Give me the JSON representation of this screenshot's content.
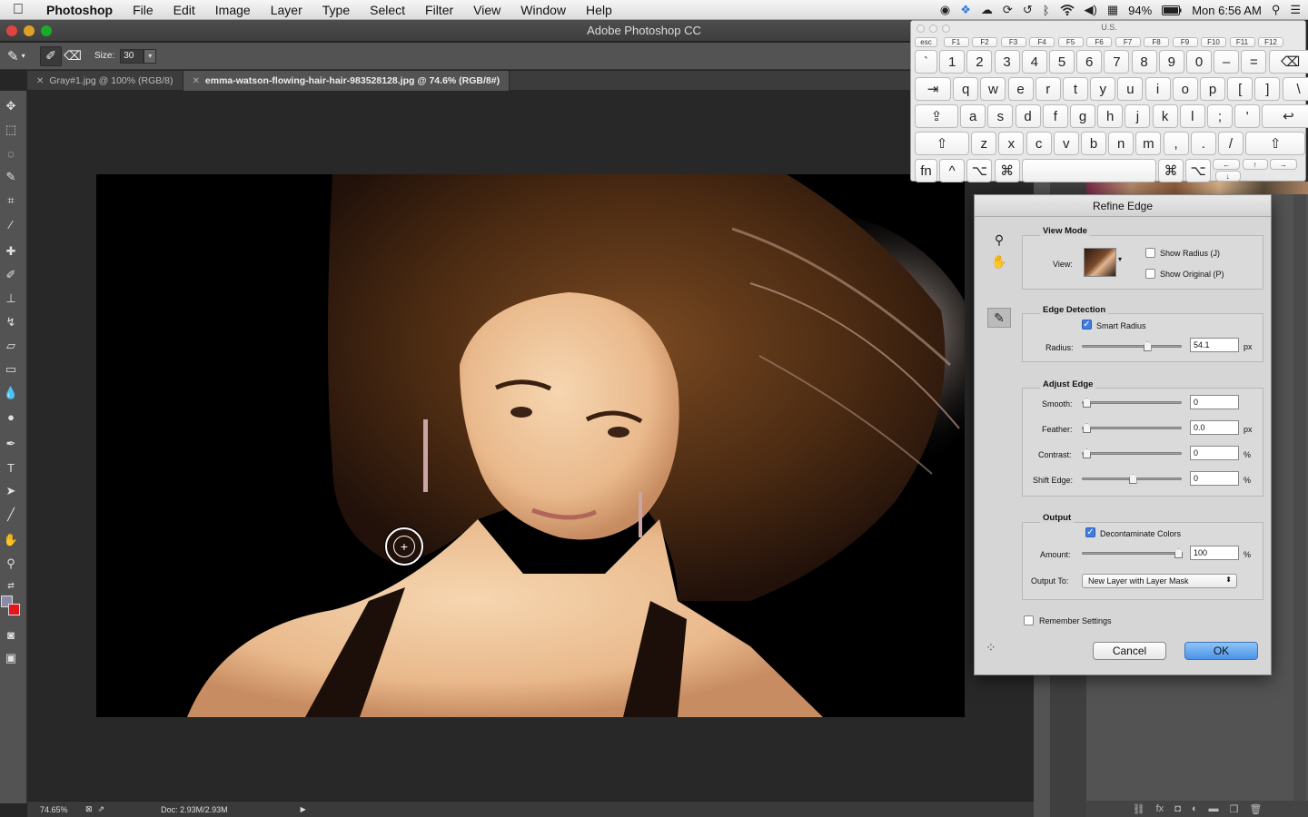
{
  "menubar": {
    "app": "Photoshop",
    "items": [
      "File",
      "Edit",
      "Image",
      "Layer",
      "Type",
      "Select",
      "Filter",
      "View",
      "Window",
      "Help"
    ],
    "battery": "94%",
    "clock": "Mon 6:56 AM"
  },
  "window": {
    "title": "Adobe Photoshop CC"
  },
  "options": {
    "size_label": "Size:",
    "size_value": "30"
  },
  "tabs": [
    {
      "label": "Gray#1.jpg @ 100% (RGB/8)"
    },
    {
      "label": "emma-watson-flowing-hair-hair-983528128.jpg @ 74.6% (RGB/8#)"
    }
  ],
  "status": {
    "zoom": "74.65%",
    "doc": "Doc: 2.93M/2.93M"
  },
  "keyboard": {
    "title": "U.S.",
    "fkeys": [
      "esc",
      "F1",
      "F2",
      "F3",
      "F4",
      "F5",
      "F6",
      "F7",
      "F8",
      "F9",
      "F10",
      "F11",
      "F12"
    ],
    "row1": [
      "`",
      "1",
      "2",
      "3",
      "4",
      "5",
      "6",
      "7",
      "8",
      "9",
      "0",
      "–",
      "=",
      "⌫"
    ],
    "row2": [
      "⇥",
      "q",
      "w",
      "e",
      "r",
      "t",
      "y",
      "u",
      "i",
      "o",
      "p",
      "[",
      "]",
      "\\"
    ],
    "row3": [
      "⇪",
      "a",
      "s",
      "d",
      "f",
      "g",
      "h",
      "j",
      "k",
      "l",
      ";",
      "'",
      "↩"
    ],
    "row4": [
      "⇧",
      "z",
      "x",
      "c",
      "v",
      "b",
      "n",
      "m",
      ",",
      ".",
      "/",
      "⇧"
    ],
    "row5": [
      "fn",
      "^",
      "⌥",
      "⌘",
      "",
      "⌘",
      "⌥",
      "←",
      "↑",
      "↓",
      "→"
    ]
  },
  "dialog": {
    "title": "Refine Edge",
    "view_mode": {
      "label": "View Mode",
      "view_label": "View:",
      "show_radius": "Show Radius (J)",
      "show_original": "Show Original (P)",
      "show_radius_checked": false,
      "show_original_checked": false
    },
    "edge_detection": {
      "label": "Edge Detection",
      "smart_radius": "Smart Radius",
      "smart_radius_checked": true,
      "radius_label": "Radius:",
      "radius_value": "54.1",
      "radius_unit": "px",
      "radius_fraction": 0.66
    },
    "adjust_edge": {
      "label": "Adjust Edge",
      "rows": [
        {
          "label": "Smooth:",
          "value": "0",
          "unit": "",
          "fraction": 0.0
        },
        {
          "label": "Feather:",
          "value": "0.0",
          "unit": "px",
          "fraction": 0.0
        },
        {
          "label": "Contrast:",
          "value": "0",
          "unit": "%",
          "fraction": 0.0
        },
        {
          "label": "Shift Edge:",
          "value": "0",
          "unit": "%",
          "fraction": 0.5
        }
      ]
    },
    "output": {
      "label": "Output",
      "decontaminate": "Decontaminate Colors",
      "decontaminate_checked": true,
      "amount_label": "Amount:",
      "amount_value": "100",
      "amount_unit": "%",
      "amount_fraction": 1.0,
      "output_to_label": "Output To:",
      "output_to_value": "New Layer with Layer Mask"
    },
    "remember": "Remember Settings",
    "remember_checked": false,
    "cancel": "Cancel",
    "ok": "OK"
  }
}
